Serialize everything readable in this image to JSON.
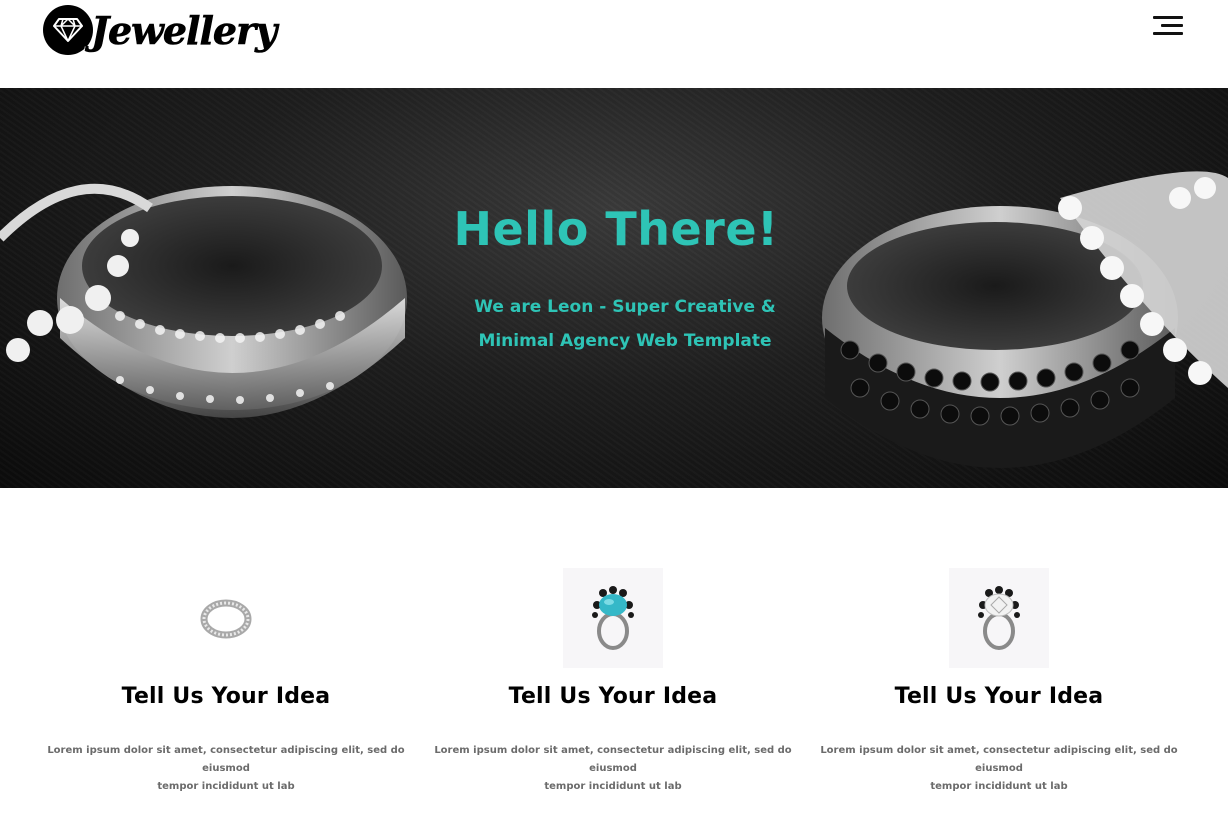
{
  "brand": {
    "name": "Jewellery",
    "icon": "diamond-icon"
  },
  "nav": {
    "menu_icon": "hamburger-menu-icon"
  },
  "hero": {
    "title": "Hello There!",
    "subtitle_line1": "We are Leon - Super Creative &",
    "subtitle_line2": "Minimal Agency Web Template",
    "accent_color": "#2ec4b6"
  },
  "features": [
    {
      "image": "silver-diamond-band-ring",
      "title": "Tell Us Your Idea",
      "text_line1": "Lorem ipsum dolor sit amet, consectetur adipiscing elit, sed do eiusmod",
      "text_line2": "tempor incididunt ut lab"
    },
    {
      "image": "turquoise-stone-ring",
      "title": "Tell Us Your Idea",
      "text_line1": "Lorem ipsum dolor sit amet, consectetur adipiscing elit, sed do eiusmod",
      "text_line2": "tempor incididunt ut lab"
    },
    {
      "image": "white-gem-cluster-ring",
      "title": "Tell Us Your Idea",
      "text_line1": "Lorem ipsum dolor sit amet, consectetur adipiscing elit, sed do eiusmod",
      "text_line2": "tempor incididunt ut lab"
    }
  ]
}
